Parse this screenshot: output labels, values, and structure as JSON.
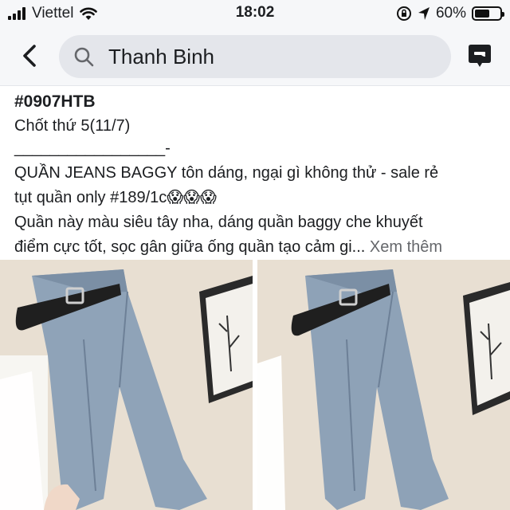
{
  "status_bar": {
    "carrier": "Viettel",
    "time": "18:02",
    "battery": "60%",
    "battery_level": 0.6,
    "icons": [
      "signal-icon",
      "wifi-icon",
      "rotation-lock-icon",
      "location-arrow-icon",
      "battery-icon"
    ]
  },
  "header": {
    "search_value": "Thanh Binh",
    "back_icon": "chevron-left-icon",
    "search_icon": "search-icon",
    "messenger_icon": "messenger-icon"
  },
  "post": {
    "lines": [
      "#0907HTB",
      "Chốt thứ 5(11/7)",
      "_________________-",
      "QUẦN JEANS BAGGY tôn dáng, ngại gì không thử - sale rẻ",
      "tụt quần only #189/1c😱😱😱",
      "Quần này màu siêu tây nha, dáng quần baggy che khuyết",
      "điểm cực tốt, sọc gân giữa ống quần tạo cảm gi... "
    ],
    "see_more": "Xem thêm"
  },
  "photos": [
    {
      "name": "jeans-photo-1"
    },
    {
      "name": "jeans-photo-2"
    }
  ]
}
